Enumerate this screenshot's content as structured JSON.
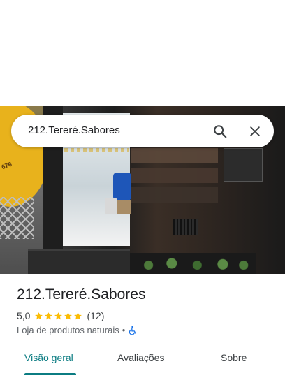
{
  "search": {
    "query": "212.Tereré.Sabores",
    "search_icon": "search-icon",
    "close_icon": "close-icon"
  },
  "photo": {
    "sign_text": "676"
  },
  "place": {
    "name": "212.Tereré.Sabores",
    "rating": "5,0",
    "stars": 5,
    "reviews": "(12)",
    "category": "Loja de produtos naturais",
    "separator": "•",
    "accessibility_icon": "wheelchair-icon"
  },
  "tabs": [
    {
      "label": "Visão geral",
      "active": true
    },
    {
      "label": "Avaliações",
      "active": false
    },
    {
      "label": "Sobre",
      "active": false
    }
  ],
  "colors": {
    "accent": "#0b7c82",
    "star": "#fbbc04",
    "accessibility": "#1a73e8"
  }
}
